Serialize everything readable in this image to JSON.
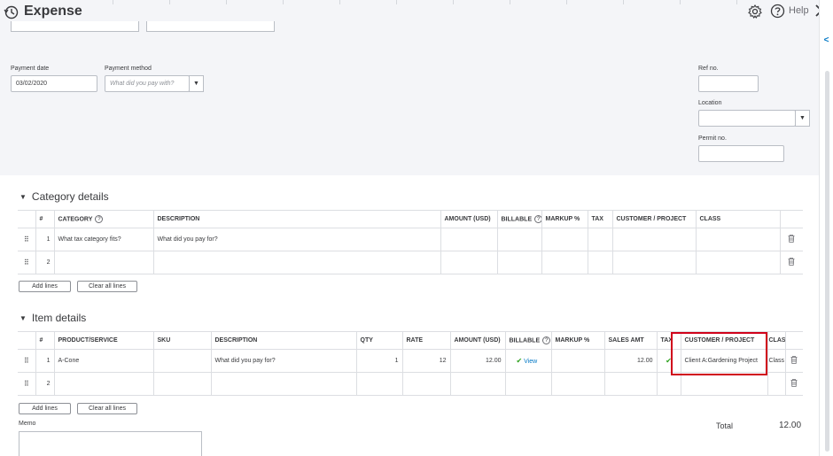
{
  "header": {
    "title": "Expense",
    "help_label": "Help"
  },
  "form": {
    "payment_date": {
      "label": "Payment date",
      "value": "03/02/2020"
    },
    "payment_method": {
      "label": "Payment method",
      "placeholder": "What did you pay with?"
    },
    "ref_no": {
      "label": "Ref no.",
      "value": ""
    },
    "location": {
      "label": "Location",
      "value": ""
    },
    "permit_no": {
      "label": "Permit no.",
      "value": ""
    }
  },
  "category_details": {
    "title": "Category details",
    "columns": [
      "#",
      "CATEGORY",
      "DESCRIPTION",
      "AMOUNT (USD)",
      "BILLABLE",
      "MARKUP %",
      "TAX",
      "CUSTOMER / PROJECT",
      "CLASS"
    ],
    "rows": [
      {
        "num": "1",
        "category_placeholder": "What tax category fits?",
        "description_placeholder": "What did you pay for?"
      },
      {
        "num": "2"
      }
    ],
    "add_lines": "Add lines",
    "clear_all": "Clear all lines"
  },
  "item_details": {
    "title": "Item details",
    "columns": [
      "#",
      "PRODUCT/SERVICE",
      "SKU",
      "DESCRIPTION",
      "QTY",
      "RATE",
      "AMOUNT (USD)",
      "BILLABLE",
      "MARKUP %",
      "SALES AMT",
      "TAX",
      "CUSTOMER / PROJECT",
      "CLASS"
    ],
    "rows": [
      {
        "num": "1",
        "product": "A-Cone",
        "sku": "",
        "description_placeholder": "What did you pay for?",
        "qty": "1",
        "rate": "12",
        "amount": "12.00",
        "billable": "View",
        "markup": "",
        "sales_amt": "12.00",
        "customer": "Client A:Gardening Project",
        "class": "Class"
      },
      {
        "num": "2"
      }
    ],
    "add_lines": "Add lines",
    "clear_all": "Clear all lines"
  },
  "footer": {
    "memo_label": "Memo",
    "total_label": "Total",
    "total_value": "12.00"
  },
  "colors": {
    "accent": "#0077c5",
    "check": "#2ca01c",
    "highlight": "#d0021b"
  }
}
